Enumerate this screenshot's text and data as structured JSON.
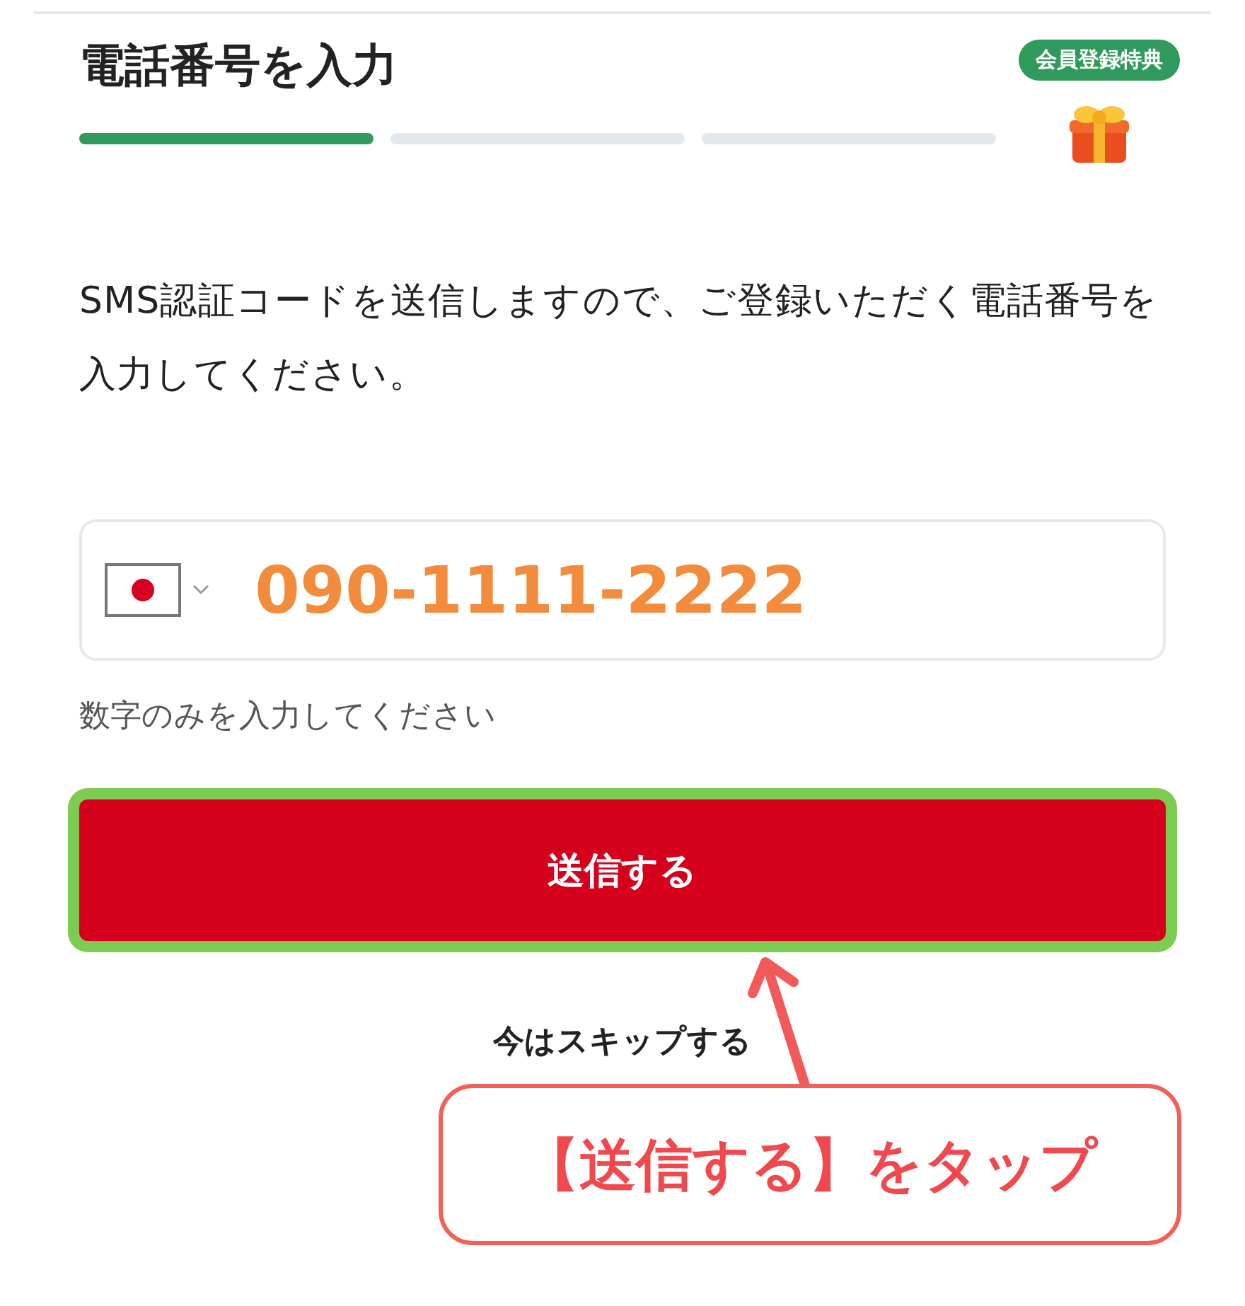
{
  "title": "電話番号を入力",
  "steps": [
    {
      "active": true
    },
    {
      "active": false
    },
    {
      "active": false
    }
  ],
  "badge": "会員登録特典",
  "description": "SMS認証コードを送信しますので、ご登録いただく電話番号を入力してください。",
  "phone_field": {
    "value": "090-1111-2222"
  },
  "hint": "数字のみを入力してください",
  "submit_button": {
    "label": "送信する",
    "highlighted": true
  },
  "skip_link": "今はスキップする",
  "callout": "【送信する】をタップ"
}
